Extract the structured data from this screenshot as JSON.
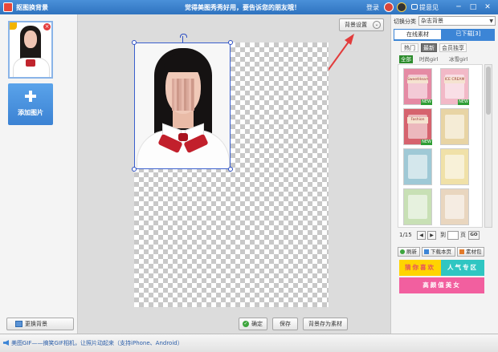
{
  "titlebar": {
    "app_title": "抠图换背景",
    "slogan": "觉得美图秀秀好用，要告诉您的朋友哦！",
    "login": "登录",
    "feedback": "提意见",
    "min_symbol": "─",
    "max_symbol": "□",
    "close_symbol": "✕"
  },
  "left_panel": {
    "thumb_close": "×",
    "add_image_label": "添加图片",
    "change_bg_label": "更换背景"
  },
  "canvas": {
    "bg_settings_label": "背景设置",
    "chevron": "⌄",
    "confirm_label": "确定",
    "check": "✓",
    "save_label": "保存",
    "save_as_material_label": "背景存为素材"
  },
  "right_panel": {
    "category_label": "切换分类",
    "category_value": "杂志背景",
    "select_arrow": "▼",
    "tab_online": "在线素材",
    "tab_downloaded": "已下载[3]",
    "subtabs": [
      "热门",
      "最新",
      "会员独享"
    ],
    "filters": [
      "全部",
      "时尚girl",
      "冰雪girl"
    ],
    "templates": [
      {
        "color": "#e58aa4",
        "tag": "SweetHeart",
        "new": true,
        "new_label": "NEW"
      },
      {
        "color": "#f2b9c7",
        "tag": "ICE CREAM",
        "new": true,
        "new_label": "NEW"
      },
      {
        "color": "#d6636e",
        "tag": "Fashion",
        "new": true,
        "new_label": "NEW"
      },
      {
        "color": "#e8d4a4",
        "tag": "",
        "new": false,
        "new_label": ""
      },
      {
        "color": "#9fc9d6",
        "tag": "",
        "new": false,
        "new_label": ""
      },
      {
        "color": "#f0e1a8",
        "tag": "",
        "new": false,
        "new_label": ""
      },
      {
        "color": "#c8e0b5",
        "tag": "",
        "new": false,
        "new_label": ""
      },
      {
        "color": "#e9d6bf",
        "tag": "",
        "new": false,
        "new_label": ""
      }
    ],
    "pager": {
      "page_text": "1/15",
      "prev": "◀",
      "next": "▶",
      "to_label": "到",
      "page_label": "页",
      "go_label": "GO"
    },
    "actions": {
      "refresh": "刷新",
      "download_page": "下载本页",
      "material_pack": "素材包"
    },
    "promos": {
      "guess": "猜你喜欢",
      "popular": "人气专区",
      "beauty": "高颜值美女"
    }
  },
  "statusbar": {
    "text": "美图GIF——搞笑GIF相机，让照片动起来（支持iPhone、Android）"
  }
}
